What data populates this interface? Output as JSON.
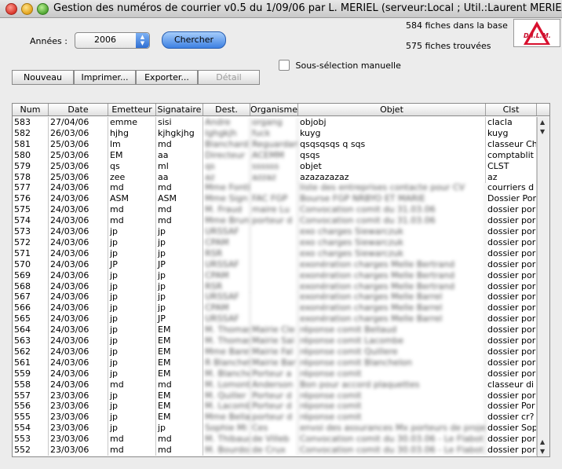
{
  "window": {
    "title": "Gestion des numéros de courrier v0.5 du 1/09/06 par L. MERIEL (serveur:Local ; Util.:Laurent MERIEL)"
  },
  "search": {
    "years_label": "Années :",
    "year_value": "2006",
    "search_button": "Chercher"
  },
  "counts": {
    "base": "584 fiches dans la base",
    "found": "575 fiches trouvées"
  },
  "logo": {
    "text": "D.I.L.M."
  },
  "manual_selection": {
    "label": "Sous-sélection manuelle",
    "checked": false
  },
  "toolbar": {
    "new": "Nouveau",
    "print": "Imprimer...",
    "export": "Exporter...",
    "detail": "Détail"
  },
  "table": {
    "columns": [
      "Num",
      "Date",
      "Emetteur",
      "Signataire",
      "Dest.",
      "Organisme",
      "Objet",
      "Clst"
    ],
    "rows": [
      [
        "583",
        "27/04/06",
        "emme",
        "sisi",
        "Andre",
        "organg",
        "objobj",
        "clacla"
      ],
      [
        "582",
        "26/03/06",
        "hjhg",
        "kjhgkjhg",
        "Ighgkjh",
        "fuck",
        "kuyg",
        "kuyg"
      ],
      [
        "581",
        "25/03/06",
        "lm",
        "md",
        "Blanchard",
        "Reguardant",
        "qsqsqsqs q sqs",
        "classeur Ch"
      ],
      [
        "580",
        "25/03/06",
        "EM",
        "aa",
        "Directeur",
        "ACEMM",
        "qsqs",
        "comptablit"
      ],
      [
        "579",
        "25/03/06",
        "qs",
        "ml",
        "qs",
        "ssssss",
        "objet",
        "CLST"
      ],
      [
        "578",
        "25/03/06",
        "zee",
        "aa",
        "az",
        "azzaz",
        "azazazazaz",
        "az"
      ],
      [
        "577",
        "24/03/06",
        "md",
        "md",
        "Mme Fonti",
        "",
        "liste des entreprises contacte pour CV",
        "courriers d"
      ],
      [
        "576",
        "24/03/06",
        "ASM",
        "ASM",
        "Mme Sign",
        "FAC FGP",
        "Bourse FGP NRBYO ET MARIE",
        "Dossier Por"
      ],
      [
        "575",
        "24/03/06",
        "md",
        "md",
        "M. Fraud",
        "maire Lu",
        "Convocation comit du 31.03.06",
        "dossier por"
      ],
      [
        "574",
        "24/03/06",
        "md",
        "md",
        "Mme Brun",
        "porteur d",
        "Convocation comit du 31.03.06",
        "dossier por"
      ],
      [
        "573",
        "24/03/06",
        "jp",
        "jp",
        "URSSAF",
        "",
        "exo charges Siewarczuk",
        "dossier por"
      ],
      [
        "572",
        "24/03/06",
        "jp",
        "jp",
        "CPAM",
        "",
        "exo charges Siewarczuk",
        "dossier por"
      ],
      [
        "571",
        "24/03/06",
        "jp",
        "jp",
        "RSR",
        "",
        "exo charges Siewarczuk",
        "dossier por"
      ],
      [
        "570",
        "24/03/06",
        "JP",
        "JP",
        "URSSAF",
        "",
        "exonération charges Melle Bertrand",
        "dossier por"
      ],
      [
        "569",
        "24/03/06",
        "jp",
        "jp",
        "CPAM",
        "",
        "exonération charges Melle Bertrand",
        "dossier por"
      ],
      [
        "568",
        "24/03/06",
        "jp",
        "jp",
        "RSR",
        "",
        "exonération charges Melle Bertrand",
        "dossier por"
      ],
      [
        "567",
        "24/03/06",
        "jp",
        "jp",
        "URSSAF",
        "",
        "exonération charges Melle Barrel",
        "dossier por"
      ],
      [
        "566",
        "24/03/06",
        "jp",
        "jp",
        "CPAM",
        "",
        "exonération charges Melle Barrel",
        "dossier por"
      ],
      [
        "565",
        "24/03/06",
        "jp",
        "JP",
        "URSSAF",
        "",
        "exonération charges Melle Barrel",
        "dossier por"
      ],
      [
        "564",
        "24/03/06",
        "jp",
        "EM",
        "M. Thomas",
        "Mairie Cle",
        "réponse comit Bellaud",
        "dossier por"
      ],
      [
        "563",
        "24/03/06",
        "jp",
        "EM",
        "M. Thomas",
        "Mairie Sai",
        "réponse comit Lacombe",
        "dossier por"
      ],
      [
        "562",
        "24/03/06",
        "jp",
        "EM",
        "Mme Baret",
        "Mairie Fal",
        "réponse comit Quillere",
        "dossier por"
      ],
      [
        "561",
        "24/03/06",
        "jp",
        "EM",
        "R Blanchet",
        "Mairie Bar",
        "réponse comit Blanchelon",
        "dossier por"
      ],
      [
        "559",
        "24/03/06",
        "jp",
        "EM",
        "M. Blanche",
        "Porteur a",
        "réponse comit",
        "dossier por"
      ],
      [
        "558",
        "24/03/06",
        "md",
        "md",
        "M. Lomont",
        "Anderson",
        "Bon pour accord plaquettes",
        "classeur di"
      ],
      [
        "557",
        "23/03/06",
        "jp",
        "EM",
        "M. Quiller",
        "Porteur d",
        "réponse comit",
        "dossier por"
      ],
      [
        "556",
        "23/03/06",
        "jp",
        "EM",
        "M. Lacombe",
        "Porteur d",
        "réponse comit",
        "dossier Por"
      ],
      [
        "555",
        "23/03/06",
        "jp",
        "EM",
        "Mme Bellau",
        "porteur d",
        "réponse comit",
        "dossier cr?"
      ],
      [
        "554",
        "23/03/06",
        "jp",
        "jp",
        "Sophie Mi",
        "Ces",
        "envoi des assurances Mx porteurs de proje",
        "dossier Sop"
      ],
      [
        "553",
        "23/03/06",
        "md",
        "md",
        "M. Thibaud",
        "de Villeb",
        "Convocation comit du 30.03.06 - Le Flabot",
        "dossier por"
      ],
      [
        "552",
        "23/03/06",
        "md",
        "md",
        "M. Bourdon",
        "de Crux",
        "Convocation comit du 30.03.06 - Le Flabot",
        "dossier por"
      ]
    ]
  }
}
